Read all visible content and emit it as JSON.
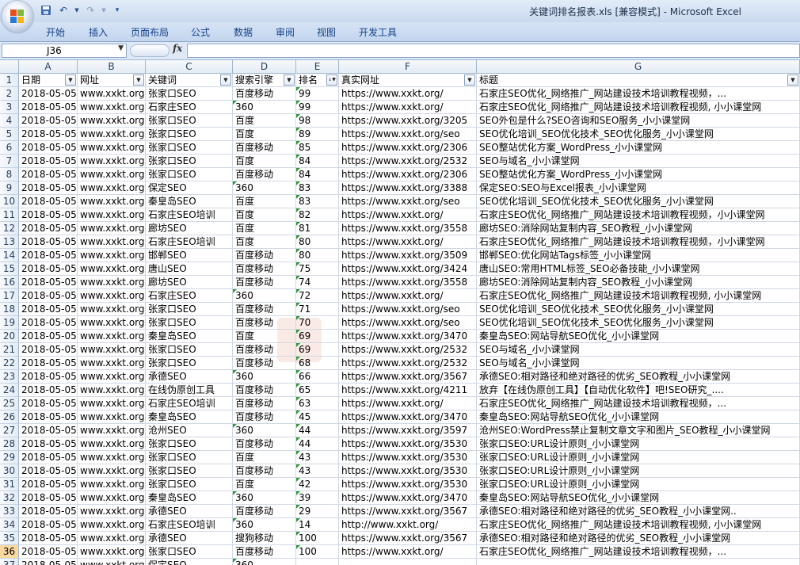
{
  "window": {
    "title": "关键词排名报表.xls  [兼容模式] - Microsoft Excel"
  },
  "quick_access": {
    "icons": [
      "save-icon",
      "undo-icon",
      "redo-icon",
      "customize-icon"
    ]
  },
  "ribbon": {
    "tabs": [
      "开始",
      "插入",
      "页面布局",
      "公式",
      "数据",
      "审阅",
      "视图",
      "开发工具"
    ]
  },
  "formula_bar": {
    "cell_ref": "J36",
    "fx_label": "fx",
    "content": ""
  },
  "columns": [
    "A",
    "B",
    "C",
    "D",
    "E",
    "F",
    "G"
  ],
  "headers": [
    "日期",
    "网址",
    "关键词",
    "搜索引擎",
    "排名",
    "真实网址",
    "标题"
  ],
  "selected_row": 36,
  "rows": [
    {
      "n": "2",
      "a": "2018-05-05",
      "b": "www.xxkt.org",
      "c": "张家口SEO",
      "d": "百度移动",
      "e": "99",
      "f": "https://www.xxkt.org/",
      "g": "石家庄SEO优化_网络推广_网站建设技术培训教程视频，..."
    },
    {
      "n": "3",
      "a": "2018-05-05",
      "b": "www.xxkt.org",
      "c": "石家庄SEO",
      "d": "360",
      "e": "99",
      "f": "https://www.xxkt.org/",
      "g": "石家庄SEO优化_网络推广_网站建设技术培训教程视频, 小小课堂网"
    },
    {
      "n": "4",
      "a": "2018-05-05",
      "b": "www.xxkt.org",
      "c": "张家口SEO",
      "d": "百度",
      "e": "98",
      "f": "https://www.xxkt.org/3205",
      "g": "SEO外包是什么?SEO咨询和SEO服务_小小课堂网"
    },
    {
      "n": "5",
      "a": "2018-05-05",
      "b": "www.xxkt.org",
      "c": "张家口SEO",
      "d": "百度",
      "e": "89",
      "f": "https://www.xxkt.org/seo",
      "g": "SEO优化培训_SEO优化技术_SEO优化服务_小小课堂网"
    },
    {
      "n": "6",
      "a": "2018-05-05",
      "b": "www.xxkt.org",
      "c": "张家口SEO",
      "d": "百度移动",
      "e": "85",
      "f": "https://www.xxkt.org/2306",
      "g": "SEO整站优化方案_WordPress_小小课堂网"
    },
    {
      "n": "7",
      "a": "2018-05-05",
      "b": "www.xxkt.org",
      "c": "张家口SEO",
      "d": "百度",
      "e": "84",
      "f": "https://www.xxkt.org/2532",
      "g": "SEO与域名_小小课堂网"
    },
    {
      "n": "8",
      "a": "2018-05-05",
      "b": "www.xxkt.org",
      "c": "张家口SEO",
      "d": "百度移动",
      "e": "84",
      "f": "https://www.xxkt.org/2306",
      "g": "SEO整站优化方案_WordPress_小小课堂网"
    },
    {
      "n": "9",
      "a": "2018-05-05",
      "b": "www.xxkt.org",
      "c": "保定SEO",
      "d": "360",
      "e": "83",
      "f": "https://www.xxkt.org/3388",
      "g": "保定SEO:SEO与Excel报表_小小课堂网"
    },
    {
      "n": "10",
      "a": "2018-05-05",
      "b": "www.xxkt.org",
      "c": "秦皇岛SEO",
      "d": "百度",
      "e": "83",
      "f": "https://www.xxkt.org/seo",
      "g": "SEO优化培训_SEO优化技术_SEO优化服务_小小课堂网"
    },
    {
      "n": "11",
      "a": "2018-05-05",
      "b": "www.xxkt.org",
      "c": "石家庄SEO培训",
      "d": "百度",
      "e": "82",
      "f": "https://www.xxkt.org/",
      "g": "石家庄SEO优化_网络推广_网站建设技术培训教程视频，小小课堂网"
    },
    {
      "n": "12",
      "a": "2018-05-05",
      "b": "www.xxkt.org",
      "c": "廊坊SEO",
      "d": "百度",
      "e": "81",
      "f": "https://www.xxkt.org/3558",
      "g": "廊坊SEO:消除网站复制内容_SEO教程_小小课堂网"
    },
    {
      "n": "13",
      "a": "2018-05-05",
      "b": "www.xxkt.org",
      "c": "石家庄SEO培训",
      "d": "百度",
      "e": "80",
      "f": "https://www.xxkt.org/",
      "g": "石家庄SEO优化_网络推广_网站建设技术培训教程视频，小小课堂网"
    },
    {
      "n": "14",
      "a": "2018-05-05",
      "b": "www.xxkt.org",
      "c": "邯郸SEO",
      "d": "百度移动",
      "e": "80",
      "f": "https://www.xxkt.org/3509",
      "g": "邯郸SEO:优化网站Tags标签_小小课堂网"
    },
    {
      "n": "15",
      "a": "2018-05-05",
      "b": "www.xxkt.org",
      "c": "唐山SEO",
      "d": "百度移动",
      "e": "75",
      "f": "https://www.xxkt.org/3424",
      "g": "唐山SEO:常用HTML标签_SEO必备技能_小小课堂网"
    },
    {
      "n": "16",
      "a": "2018-05-05",
      "b": "www.xxkt.org",
      "c": "廊坊SEO",
      "d": "百度移动",
      "e": "74",
      "f": "https://www.xxkt.org/3558",
      "g": "廊坊SEO:消除网站复制内容_SEO教程_小小课堂网"
    },
    {
      "n": "17",
      "a": "2018-05-05",
      "b": "www.xxkt.org",
      "c": "石家庄SEO",
      "d": "360",
      "e": "72",
      "f": "https://www.xxkt.org/",
      "g": "石家庄SEO优化_网络推广_网站建设技术培训教程视频, 小小课堂网"
    },
    {
      "n": "18",
      "a": "2018-05-05",
      "b": "www.xxkt.org",
      "c": "张家口SEO",
      "d": "百度移动",
      "e": "71",
      "f": "https://www.xxkt.org/seo",
      "g": "SEO优化培训_SEO优化技术_SEO优化服务_小小课堂网"
    },
    {
      "n": "19",
      "a": "2018-05-05",
      "b": "www.xxkt.org",
      "c": "张家口SEO",
      "d": "百度移动",
      "e": "70",
      "f": "https://www.xxkt.org/seo",
      "g": "SEO优化培训_SEO优化技术_SEO优化服务_小小课堂网"
    },
    {
      "n": "20",
      "a": "2018-05-05",
      "b": "www.xxkt.org",
      "c": "秦皇岛SEO",
      "d": "百度",
      "e": "69",
      "f": "https://www.xxkt.org/3470",
      "g": "秦皇岛SEO:网站导航SEO优化_小小课堂网"
    },
    {
      "n": "21",
      "a": "2018-05-05",
      "b": "www.xxkt.org",
      "c": "张家口SEO",
      "d": "百度移动",
      "e": "69",
      "f": "https://www.xxkt.org/2532",
      "g": "SEO与域名_小小课堂网"
    },
    {
      "n": "22",
      "a": "2018-05-05",
      "b": "www.xxkt.org",
      "c": "张家口SEO",
      "d": "百度移动",
      "e": "68",
      "f": "https://www.xxkt.org/2532",
      "g": "SEO与域名_小小课堂网"
    },
    {
      "n": "23",
      "a": "2018-05-05",
      "b": "www.xxkt.org",
      "c": "承德SEO",
      "d": "360",
      "e": "66",
      "f": "https://www.xxkt.org/3567",
      "g": "承德SEO:相对路径和绝对路径的优劣_SEO教程_小小课堂网"
    },
    {
      "n": "24",
      "a": "2018-05-05",
      "b": "www.xxkt.org",
      "c": "在线伪原创工具",
      "d": "百度移动",
      "e": "65",
      "f": "https://www.xxkt.org/4211",
      "g": "放弃【在线伪原创工具】【自动优化软件】吧!SEO研究_...."
    },
    {
      "n": "25",
      "a": "2018-05-05",
      "b": "www.xxkt.org",
      "c": "石家庄SEO培训",
      "d": "百度移动",
      "e": "63",
      "f": "https://www.xxkt.org/",
      "g": "石家庄SEO优化_网络推广_网站建设技术培训教程视频，..."
    },
    {
      "n": "26",
      "a": "2018-05-05",
      "b": "www.xxkt.org",
      "c": "秦皇岛SEO",
      "d": "百度移动",
      "e": "45",
      "f": "https://www.xxkt.org/3470",
      "g": "秦皇岛SEO:网站导航SEO优化_小小课堂网"
    },
    {
      "n": "27",
      "a": "2018-05-05",
      "b": "www.xxkt.org",
      "c": "沧州SEO",
      "d": "360",
      "e": "44",
      "f": "https://www.xxkt.org/3597",
      "g": "沧州SEO:WordPress禁止复制文章文字和图片_SEO教程_小小课堂网"
    },
    {
      "n": "28",
      "a": "2018-05-05",
      "b": "www.xxkt.org",
      "c": "张家口SEO",
      "d": "百度移动",
      "e": "44",
      "f": "https://www.xxkt.org/3530",
      "g": "张家口SEO:URL设计原则_小小课堂网"
    },
    {
      "n": "29",
      "a": "2018-05-05",
      "b": "www.xxkt.org",
      "c": "张家口SEO",
      "d": "百度",
      "e": "43",
      "f": "https://www.xxkt.org/3530",
      "g": "张家口SEO:URL设计原则_小小课堂网"
    },
    {
      "n": "30",
      "a": "2018-05-05",
      "b": "www.xxkt.org",
      "c": "张家口SEO",
      "d": "百度移动",
      "e": "43",
      "f": "https://www.xxkt.org/3530",
      "g": "张家口SEO:URL设计原则_小小课堂网"
    },
    {
      "n": "31",
      "a": "2018-05-05",
      "b": "www.xxkt.org",
      "c": "张家口SEO",
      "d": "百度",
      "e": "42",
      "f": "https://www.xxkt.org/3530",
      "g": "张家口SEO:URL设计原则_小小课堂网"
    },
    {
      "n": "32",
      "a": "2018-05-05",
      "b": "www.xxkt.org",
      "c": "秦皇岛SEO",
      "d": "360",
      "e": "39",
      "f": "https://www.xxkt.org/3470",
      "g": "秦皇岛SEO:网站导航SEO优化_小小课堂网"
    },
    {
      "n": "33",
      "a": "2018-05-05",
      "b": "www.xxkt.org",
      "c": "承德SEO",
      "d": "百度移动",
      "e": "29",
      "f": "https://www.xxkt.org/3567",
      "g": "承德SEO:相对路径和绝对路径的优劣_SEO教程_小小课堂网.."
    },
    {
      "n": "34",
      "a": "2018-05-05",
      "b": "www.xxkt.org",
      "c": "石家庄SEO培训",
      "d": "360",
      "e": "14",
      "f": "http://www.xxkt.org/",
      "g": "石家庄SEO优化_网络推广_网站建设技术培训教程视频, 小小课堂网"
    },
    {
      "n": "35",
      "a": "2018-05-05",
      "b": "www.xxkt.org",
      "c": "承德SEO",
      "d": "搜狗移动",
      "e": "100",
      "f": "https://www.xxkt.org/3567",
      "g": "承德SEO:相对路径和绝对路径的优劣_SEO教程_小小课堂网"
    },
    {
      "n": "36",
      "a": "2018-05-05",
      "b": "www.xxkt.org",
      "c": "张家口SEO",
      "d": "百度移动",
      "e": "100",
      "f": "https://www.xxkt.org/",
      "g": "石家庄SEO优化_网络推广_网站建设技术培训教程视频，..."
    },
    {
      "n": "37",
      "a": "2018-05-05",
      "b": "www.xxkt.org",
      "c": "保定SEO",
      "d": "360",
      "e": "",
      "f": "",
      "g": ""
    }
  ]
}
